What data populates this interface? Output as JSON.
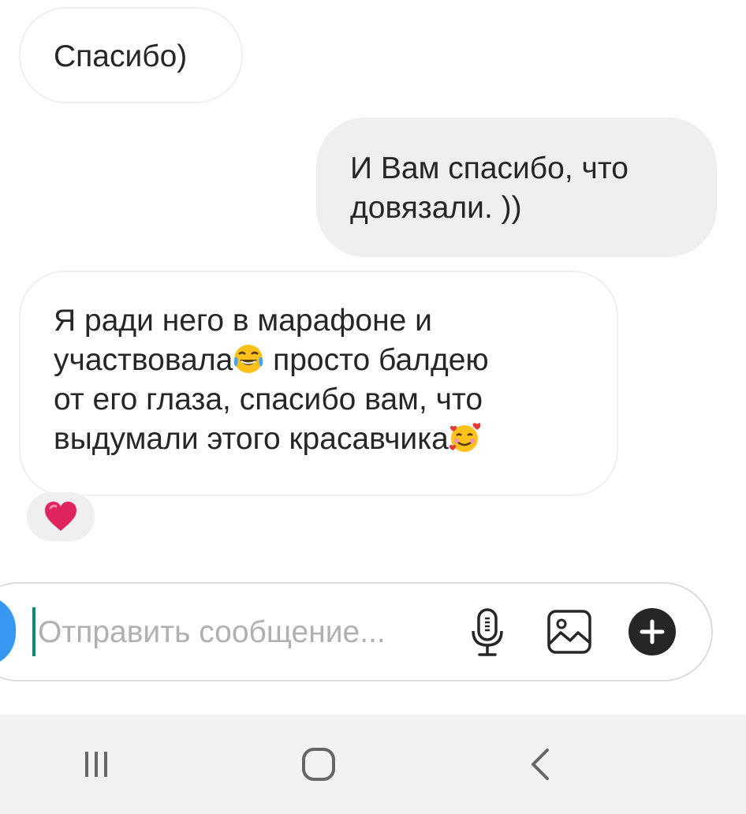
{
  "thread": {
    "messages": [
      {
        "direction": "incoming",
        "text": "Спасибо)"
      },
      {
        "direction": "outgoing",
        "lines": [
          "И Вам спасибо, что",
          "довязали. ))"
        ]
      },
      {
        "direction": "incoming",
        "lines": [
          "Я ради него в марафоне и",
          "участвовала",
          " просто балдею",
          "от его глаза, спасибо вам, что",
          "выдумали этого красавчика"
        ],
        "emojis": [
          "face-with-tears-of-joy-emoji",
          "smiling-face-with-hearts-emoji"
        ]
      }
    ],
    "reaction": {
      "icon": "red-heart-icon"
    }
  },
  "composer": {
    "placeholder": "Отправить сообщение...",
    "value": "",
    "buttons": [
      "microphone-icon",
      "gallery-icon",
      "plus-icon"
    ]
  },
  "colors": {
    "incoming_border": "#efefef",
    "outgoing_bg": "#efefef",
    "text": "#262626",
    "placeholder": "#b0b0b0",
    "heart": "#e0245e",
    "avatar": "#3897f0",
    "cursor": "#0a8a7a",
    "navbar_bg": "#f2f2f2"
  },
  "navbar": {
    "buttons": [
      "recent-apps-icon",
      "home-icon",
      "back-icon"
    ]
  }
}
